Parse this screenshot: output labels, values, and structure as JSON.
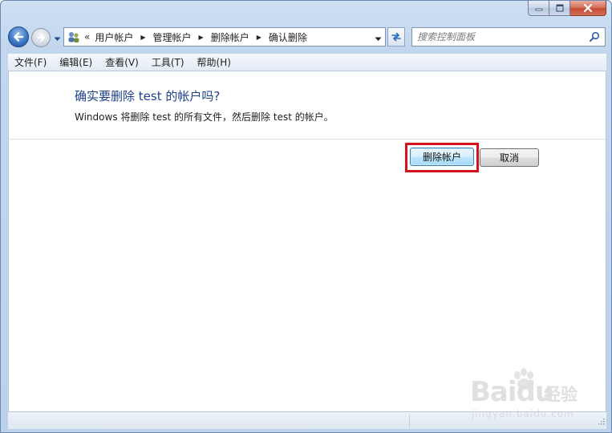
{
  "window": {
    "icons": {
      "minimize": "minimize-icon",
      "maximize": "maximize-icon",
      "close": "close-icon"
    }
  },
  "address_bar": {
    "overflow_chevron": "«",
    "breadcrumbs": [
      "用户帐户",
      "管理帐户",
      "删除帐户",
      "确认删除"
    ]
  },
  "search": {
    "placeholder": "搜索控制面板"
  },
  "menu": {
    "items": [
      "文件(F)",
      "编辑(E)",
      "查看(V)",
      "工具(T)",
      "帮助(H)"
    ]
  },
  "main": {
    "heading": "确实要删除 test 的帐户吗?",
    "description": "Windows 将删除 test 的所有文件，然后删除 test 的帐户。",
    "buttons": {
      "delete_label": "删除帐户",
      "cancel_label": "取消"
    }
  },
  "colors": {
    "heading": "#1e3f8a",
    "highlight_box": "#d4121b",
    "close_button": "#c44a32"
  },
  "watermark": {
    "logo": "Baidu",
    "brand": "经验",
    "url": "jingyan.baidu.com"
  }
}
